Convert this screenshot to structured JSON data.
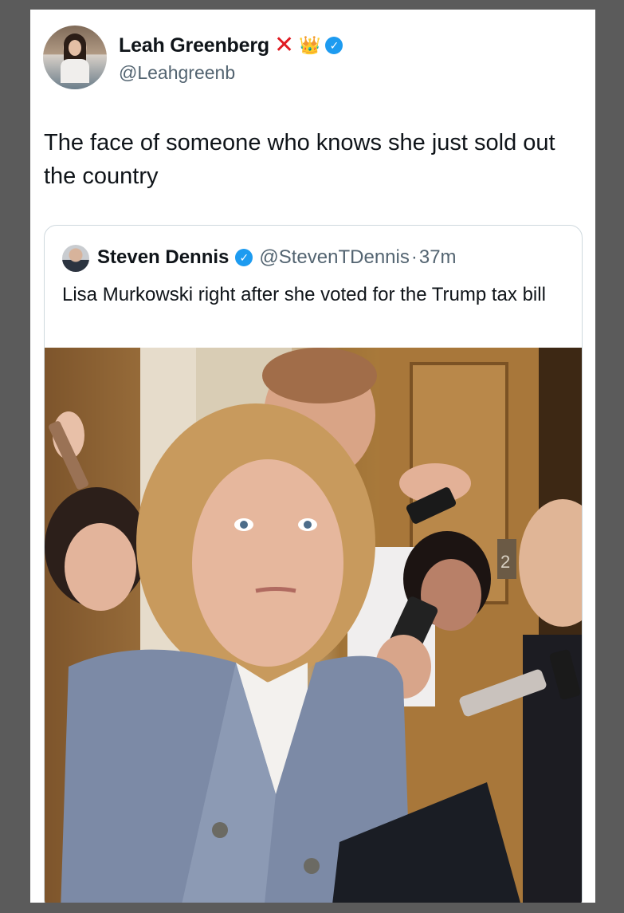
{
  "tweet": {
    "author": {
      "name": "Leah Greenberg",
      "badge_x": "✕",
      "badge_crown": "👑",
      "verified_mark": "✓",
      "handle": "@Leahgreenb"
    },
    "text": "The face of someone who knows she just sold out the country"
  },
  "quoted_tweet": {
    "author": {
      "name": "Steven Dennis",
      "verified_mark": "✓",
      "handle": "@StevenTDennis",
      "separator": "·",
      "time": "37m"
    },
    "text": "Lisa Murkowski right after she voted for the Trump tax bill",
    "elevator_sign": "2"
  },
  "colors": {
    "verified": "#1d9bf0",
    "badge_x": "#e01b22",
    "secondary_text": "#536471"
  }
}
